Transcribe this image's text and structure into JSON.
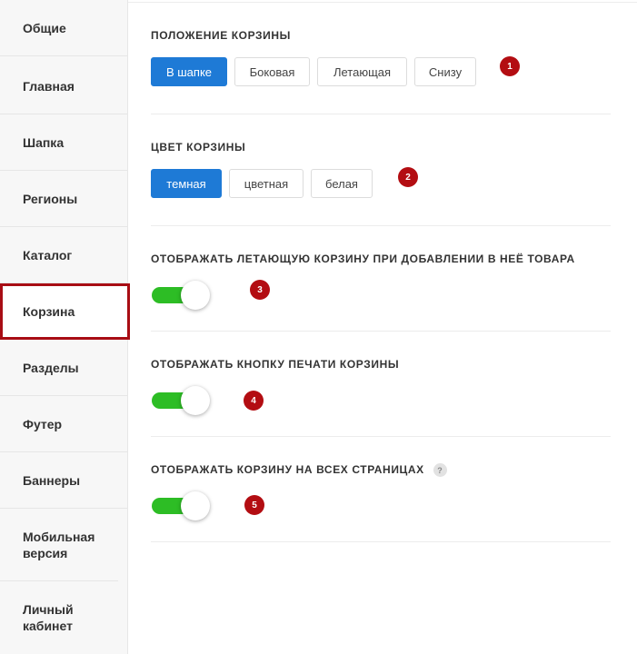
{
  "sidebar": {
    "items": [
      {
        "label": "Общие"
      },
      {
        "label": "Главная"
      },
      {
        "label": "Шапка"
      },
      {
        "label": "Регионы"
      },
      {
        "label": "Каталог"
      },
      {
        "label": "Корзина",
        "active": true
      },
      {
        "label": "Разделы"
      },
      {
        "label": "Футер"
      },
      {
        "label": "Баннеры"
      },
      {
        "label": "Мобильная версия"
      },
      {
        "label": "Личный кабинет"
      }
    ],
    "active_outline_color": "#a80d14"
  },
  "sections": {
    "cart_position": {
      "title": "ПОЛОЖЕНИЕ КОРЗИНЫ",
      "options": [
        "В шапке",
        "Боковая",
        "Летающая",
        "Снизу"
      ],
      "selected": "В шапке",
      "badge": "1"
    },
    "cart_color": {
      "title": "ЦВЕТ КОРЗИНЫ",
      "options": [
        "темная",
        "цветная",
        "белая"
      ],
      "selected": "темная",
      "badge": "2"
    },
    "fly_cart": {
      "title": "ОТОБРАЖАТЬ ЛЕТАЮЩУЮ КОРЗИНУ ПРИ ДОБАВЛЕНИИ В НЕЁ ТОВАРА",
      "enabled": true,
      "badge": "3"
    },
    "print_button": {
      "title": "ОТОБРАЖАТЬ КНОПКУ ПЕЧАТИ КОРЗИНЫ",
      "enabled": true,
      "badge": "4"
    },
    "all_pages": {
      "title": "ОТОБРАЖАТЬ КОРЗИНУ НА ВСЕХ СТРАНИЦАХ",
      "help": "?",
      "enabled": true,
      "badge": "5"
    }
  },
  "colors": {
    "selected_button": "#1e7ad6",
    "toggle_on": "#2dbd25",
    "badge": "#b30d12"
  }
}
